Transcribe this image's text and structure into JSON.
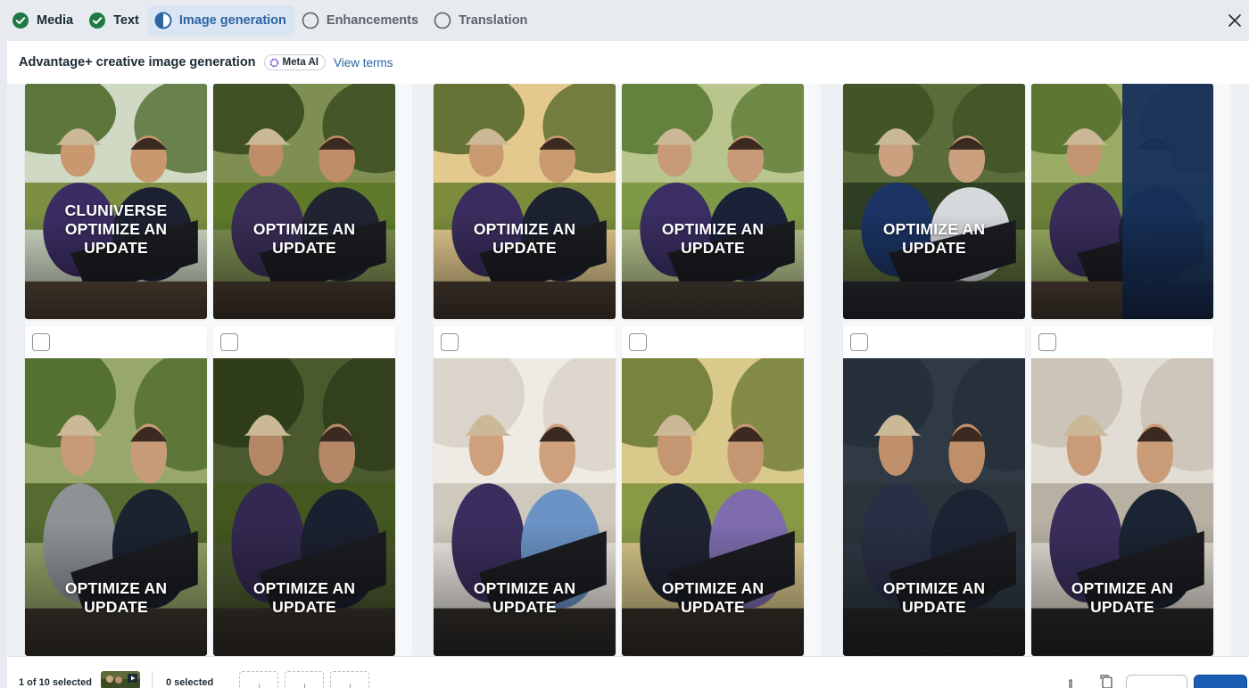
{
  "stepper": {
    "steps": [
      {
        "label": "Media",
        "state": "complete"
      },
      {
        "label": "Text",
        "state": "complete"
      },
      {
        "label": "Image generation",
        "state": "active"
      },
      {
        "label": "Enhancements",
        "state": "pending"
      },
      {
        "label": "Translation",
        "state": "pending"
      }
    ],
    "close_icon": "close-icon"
  },
  "header": {
    "title": "Advantage+ creative image generation",
    "badge": "Meta AI",
    "link": "View terms"
  },
  "colors": {
    "accent": "#2d64a4",
    "complete_green": "#1e7a45",
    "primary_button": "#1b5fb5",
    "active_step_bg": "#d9e5f3"
  },
  "groups": [
    {
      "cards": [
        {
          "row": "top",
          "overlay": "CLUNIVERSE\nOPTIMIZE AN\nUPDATE",
          "scene": "park-bright",
          "has_checkbox": false
        },
        {
          "row": "top",
          "overlay": "OPTIMIZE AN\nUPDATE",
          "scene": "park-dusk",
          "has_checkbox": false
        },
        {
          "row": "bottom",
          "overlay": "OPTIMIZE AN\nUPDATE",
          "scene": "portrait-greenery",
          "has_checkbox": true
        },
        {
          "row": "bottom",
          "overlay": "OPTIMIZE AN\nUPDATE",
          "scene": "park-dark-trees",
          "has_checkbox": true
        }
      ]
    },
    {
      "cards": [
        {
          "row": "top",
          "overlay": "OPTIMIZE AN\nUPDATE",
          "scene": "park-sunset",
          "has_checkbox": false
        },
        {
          "row": "top",
          "overlay": "OPTIMIZE AN\nUPDATE",
          "scene": "park-daylight",
          "has_checkbox": false
        },
        {
          "row": "bottom",
          "overlay": "OPTIMIZE AN\nUPDATE",
          "scene": "indoor-bright",
          "has_checkbox": true
        },
        {
          "row": "bottom",
          "overlay": "OPTIMIZE AN\nUPDATE",
          "scene": "park-golden",
          "has_checkbox": true
        }
      ]
    },
    {
      "cards": [
        {
          "row": "top",
          "overlay": "OPTIMIZE AN\nUPDATE",
          "scene": "closeup-navy",
          "has_checkbox": false
        },
        {
          "row": "top",
          "overlay": "",
          "scene": "park-navy-panel",
          "has_checkbox": false
        },
        {
          "row": "bottom",
          "overlay": "OPTIMIZE AN\nUPDATE",
          "scene": "portrait-dark",
          "has_checkbox": true
        },
        {
          "row": "bottom",
          "overlay": "OPTIMIZE AN\nUPDATE",
          "scene": "indoor-portrait",
          "has_checkbox": true
        }
      ]
    }
  ],
  "footer": {
    "left_count": "1 of 10 selected",
    "right_count": "0 selected",
    "thumb_icon": "video-thumbnail",
    "slot_icon": "plus-icon",
    "icons": [
      "hand-icon",
      "copy-icon"
    ],
    "buttons": {
      "secondary": "",
      "primary": ""
    }
  }
}
